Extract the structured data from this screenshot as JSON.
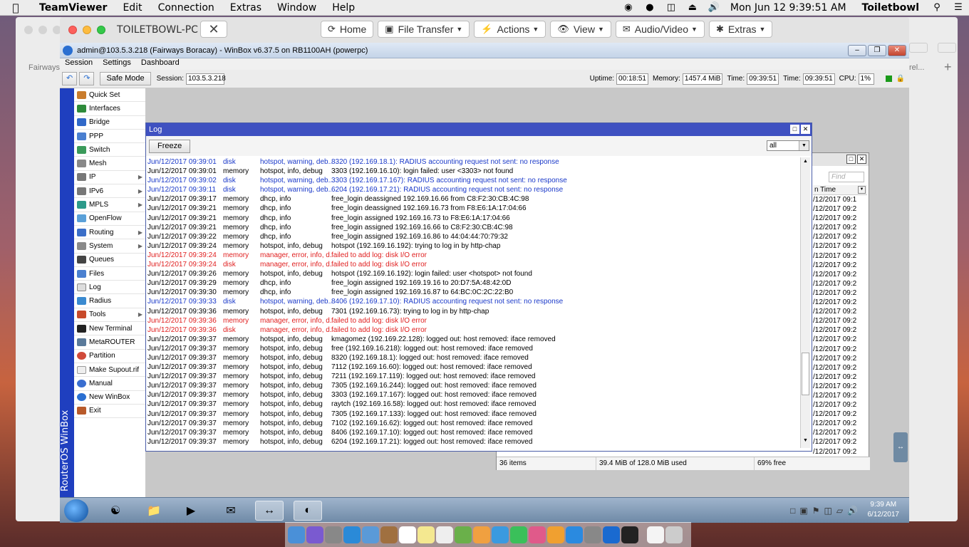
{
  "mac_menubar": {
    "app": "TeamViewer",
    "items": [
      "Edit",
      "Connection",
      "Extras",
      "Window",
      "Help"
    ],
    "clock": "Mon Jun 12  9:39:51 AM",
    "user": "Toiletbowl",
    "status_icons": [
      "nvidia-icon",
      "teamviewer-status-icon",
      "display-icon",
      "eject-icon",
      "volume-icon"
    ]
  },
  "teamviewer": {
    "title": "TOILETBOWL-PC",
    "buttons": [
      {
        "label": "Home",
        "icon": "home-icon"
      },
      {
        "label": "File Transfer",
        "icon": "file-transfer-icon"
      },
      {
        "label": "Actions",
        "icon": "actions-icon"
      },
      {
        "label": "View",
        "icon": "eye-icon"
      },
      {
        "label": "Audio/Video",
        "icon": "chat-icon"
      },
      {
        "label": "Extras",
        "icon": "wrench-icon"
      }
    ],
    "bg_tab_left": "Fairways",
    "bg_tab_right": "rel..."
  },
  "winbox": {
    "title": "admin@103.5.3.218 (Fairways Boracay) - WinBox v6.37.5 on RB1100AH (powerpc)",
    "menu": [
      "Session",
      "Settings",
      "Dashboard"
    ],
    "safe_mode": "Safe Mode",
    "session_label": "Session:",
    "session_value": "103.5.3.218",
    "uptime_label": "Uptime:",
    "uptime_value": "00:18:51",
    "memory_label": "Memory:",
    "memory_value": "1457.4 MiB",
    "time_label": "Time:",
    "time_value": "09:39:51",
    "time2_label": "Time:",
    "time2_value": "09:39:51",
    "cpu_label": "CPU:",
    "cpu_value": "1%",
    "side_label": "RouterOS WinBox",
    "sidemenu": [
      {
        "label": "Quick Set",
        "arrow": false
      },
      {
        "label": "Interfaces",
        "arrow": false
      },
      {
        "label": "Bridge",
        "arrow": false
      },
      {
        "label": "PPP",
        "arrow": false
      },
      {
        "label": "Switch",
        "arrow": false
      },
      {
        "label": "Mesh",
        "arrow": false
      },
      {
        "label": "IP",
        "arrow": true
      },
      {
        "label": "IPv6",
        "arrow": true
      },
      {
        "label": "MPLS",
        "arrow": true
      },
      {
        "label": "OpenFlow",
        "arrow": false
      },
      {
        "label": "Routing",
        "arrow": true
      },
      {
        "label": "System",
        "arrow": true
      },
      {
        "label": "Queues",
        "arrow": false
      },
      {
        "label": "Files",
        "arrow": false
      },
      {
        "label": "Log",
        "arrow": false
      },
      {
        "label": "Radius",
        "arrow": false
      },
      {
        "label": "Tools",
        "arrow": true
      },
      {
        "label": "New Terminal",
        "arrow": false
      },
      {
        "label": "MetaROUTER",
        "arrow": false
      },
      {
        "label": "Partition",
        "arrow": false
      },
      {
        "label": "Make Supout.rif",
        "arrow": false
      },
      {
        "label": "Manual",
        "arrow": false
      },
      {
        "label": "New WinBox",
        "arrow": false
      },
      {
        "label": "Exit",
        "arrow": false
      }
    ]
  },
  "log_window": {
    "title": "Log",
    "freeze": "Freeze",
    "filter": "all",
    "rows": [
      {
        "t": "Jun/12/2017 09:39:01",
        "b": "disk",
        "topics": "hotspot, warning, deb...",
        "msg": "8320 (192.169.18.1): RADIUS accounting request not sent: no response",
        "c": "blue"
      },
      {
        "t": "Jun/12/2017 09:39:01",
        "b": "memory",
        "topics": "hotspot, info, debug",
        "msg": "3303 (192.169.16.10): login failed: user <3303> not found",
        "c": ""
      },
      {
        "t": "Jun/12/2017 09:39:02",
        "b": "disk",
        "topics": "hotspot, warning, deb...",
        "msg": "3303 (192.169.17.167): RADIUS accounting request not sent: no response",
        "c": "blue"
      },
      {
        "t": "Jun/12/2017 09:39:11",
        "b": "disk",
        "topics": "hotspot, warning, deb...",
        "msg": "6204 (192.169.17.21): RADIUS accounting request not sent: no response",
        "c": "blue"
      },
      {
        "t": "Jun/12/2017 09:39:17",
        "b": "memory",
        "topics": "dhcp, info",
        "msg": "free_login deassigned 192.169.16.66 from C8:F2:30:CB:4C:98",
        "c": ""
      },
      {
        "t": "Jun/12/2017 09:39:21",
        "b": "memory",
        "topics": "dhcp, info",
        "msg": "free_login deassigned 192.169.16.73 from F8:E6:1A:17:04:66",
        "c": ""
      },
      {
        "t": "Jun/12/2017 09:39:21",
        "b": "memory",
        "topics": "dhcp, info",
        "msg": "free_login assigned 192.169.16.73 to F8:E6:1A:17:04:66",
        "c": ""
      },
      {
        "t": "Jun/12/2017 09:39:21",
        "b": "memory",
        "topics": "dhcp, info",
        "msg": "free_login assigned 192.169.16.66 to C8:F2:30:CB:4C:98",
        "c": ""
      },
      {
        "t": "Jun/12/2017 09:39:22",
        "b": "memory",
        "topics": "dhcp, info",
        "msg": "free_login assigned 192.169.16.86 to 44:04:44:70:79:32",
        "c": ""
      },
      {
        "t": "Jun/12/2017 09:39:24",
        "b": "memory",
        "topics": "hotspot, info, debug",
        "msg": "hotspot (192.169.16.192): trying to log in by http-chap",
        "c": ""
      },
      {
        "t": "Jun/12/2017 09:39:24",
        "b": "memory",
        "topics": "manager, error, info, d...",
        "msg": "failed to add log: disk I/O error",
        "c": "red"
      },
      {
        "t": "Jun/12/2017 09:39:24",
        "b": "disk",
        "topics": "manager, error, info, d...",
        "msg": "failed to add log: disk I/O error",
        "c": "red"
      },
      {
        "t": "Jun/12/2017 09:39:26",
        "b": "memory",
        "topics": "hotspot, info, debug",
        "msg": "hotspot (192.169.16.192): login failed: user <hotspot> not found",
        "c": ""
      },
      {
        "t": "Jun/12/2017 09:39:29",
        "b": "memory",
        "topics": "dhcp, info",
        "msg": "free_login assigned 192.169.19.16 to 20:D7:5A:48:42:0D",
        "c": ""
      },
      {
        "t": "Jun/12/2017 09:39:30",
        "b": "memory",
        "topics": "dhcp, info",
        "msg": "free_login assigned 192.169.16.87 to 64:BC:0C:2C:22:B0",
        "c": ""
      },
      {
        "t": "Jun/12/2017 09:39:33",
        "b": "disk",
        "topics": "hotspot, warning, deb...",
        "msg": "8406 (192.169.17.10): RADIUS accounting request not sent: no response",
        "c": "blue"
      },
      {
        "t": "Jun/12/2017 09:39:36",
        "b": "memory",
        "topics": "hotspot, info, debug",
        "msg": "7301 (192.169.16.73): trying to log in by http-chap",
        "c": ""
      },
      {
        "t": "Jun/12/2017 09:39:36",
        "b": "memory",
        "topics": "manager, error, info, d...",
        "msg": "failed to add log: disk I/O error",
        "c": "red"
      },
      {
        "t": "Jun/12/2017 09:39:36",
        "b": "disk",
        "topics": "manager, error, info, d...",
        "msg": "failed to add log: disk I/O error",
        "c": "red"
      },
      {
        "t": "Jun/12/2017 09:39:37",
        "b": "memory",
        "topics": "hotspot, info, debug",
        "msg": "kmagomez (192.169.22.128): logged out: host removed: iface removed",
        "c": ""
      },
      {
        "t": "Jun/12/2017 09:39:37",
        "b": "memory",
        "topics": "hotspot, info, debug",
        "msg": "free (192.169.16.218): logged out: host removed: iface removed",
        "c": ""
      },
      {
        "t": "Jun/12/2017 09:39:37",
        "b": "memory",
        "topics": "hotspot, info, debug",
        "msg": "8320 (192.169.18.1): logged out: host removed: iface removed",
        "c": ""
      },
      {
        "t": "Jun/12/2017 09:39:37",
        "b": "memory",
        "topics": "hotspot, info, debug",
        "msg": "7112 (192.169.16.60): logged out: host removed: iface removed",
        "c": ""
      },
      {
        "t": "Jun/12/2017 09:39:37",
        "b": "memory",
        "topics": "hotspot, info, debug",
        "msg": "7211 (192.169.17.119): logged out: host removed: iface removed",
        "c": ""
      },
      {
        "t": "Jun/12/2017 09:39:37",
        "b": "memory",
        "topics": "hotspot, info, debug",
        "msg": "7305 (192.169.16.244): logged out: host removed: iface removed",
        "c": ""
      },
      {
        "t": "Jun/12/2017 09:39:37",
        "b": "memory",
        "topics": "hotspot, info, debug",
        "msg": "3303 (192.169.17.167): logged out: host removed: iface removed",
        "c": ""
      },
      {
        "t": "Jun/12/2017 09:39:37",
        "b": "memory",
        "topics": "hotspot, info, debug",
        "msg": "raytch (192.169.16.58): logged out: host removed: iface removed",
        "c": ""
      },
      {
        "t": "Jun/12/2017 09:39:37",
        "b": "memory",
        "topics": "hotspot, info, debug",
        "msg": "7305 (192.169.17.133): logged out: host removed: iface removed",
        "c": ""
      },
      {
        "t": "Jun/12/2017 09:39:37",
        "b": "memory",
        "topics": "hotspot, info, debug",
        "msg": "7102 (192.169.16.62): logged out: host removed: iface removed",
        "c": ""
      },
      {
        "t": "Jun/12/2017 09:39:37",
        "b": "memory",
        "topics": "hotspot, info, debug",
        "msg": "8406 (192.169.17.10): logged out: host removed: iface removed",
        "c": ""
      },
      {
        "t": "Jun/12/2017 09:39:37",
        "b": "memory",
        "topics": "hotspot, info, debug",
        "msg": "6204 (192.169.17.21): logged out: host removed: iface removed",
        "c": ""
      }
    ]
  },
  "files_window": {
    "find_placeholder": "Find",
    "col_header": "n Time",
    "rows": [
      "/12/2017 09:1",
      "/12/2017 09:2",
      "/12/2017 09:2",
      "/12/2017 09:2",
      "/12/2017 09:2",
      "/12/2017 09:2",
      "/12/2017 09:2",
      "/12/2017 09:2",
      "/12/2017 09:2",
      "/12/2017 09:2",
      "/12/2017 09:2",
      "/12/2017 09:2",
      "/12/2017 09:2",
      "/12/2017 09:2",
      "/12/2017 09:2",
      "/12/2017 09:2",
      "/12/2017 09:2",
      "/12/2017 09:2",
      "/12/2017 09:2",
      "/12/2017 09:2",
      "/12/2017 09:2",
      "/12/2017 09:2",
      "/12/2017 09:2",
      "/12/2017 09:2",
      "/12/2017 09:2",
      "/12/2017 09:2",
      "/12/2017 09:2",
      "/12/2017 09:2"
    ],
    "status_items": "36 items",
    "status_used": "39.4 MiB of 128.0 MiB used",
    "status_free": "69% free"
  },
  "win_taskbar": {
    "time": "9:39 AM",
    "date": "6/12/2017"
  },
  "colors": {
    "log_blue": "#1a39c9",
    "log_red": "#e02020",
    "winbox_title": "#3f51c1"
  }
}
